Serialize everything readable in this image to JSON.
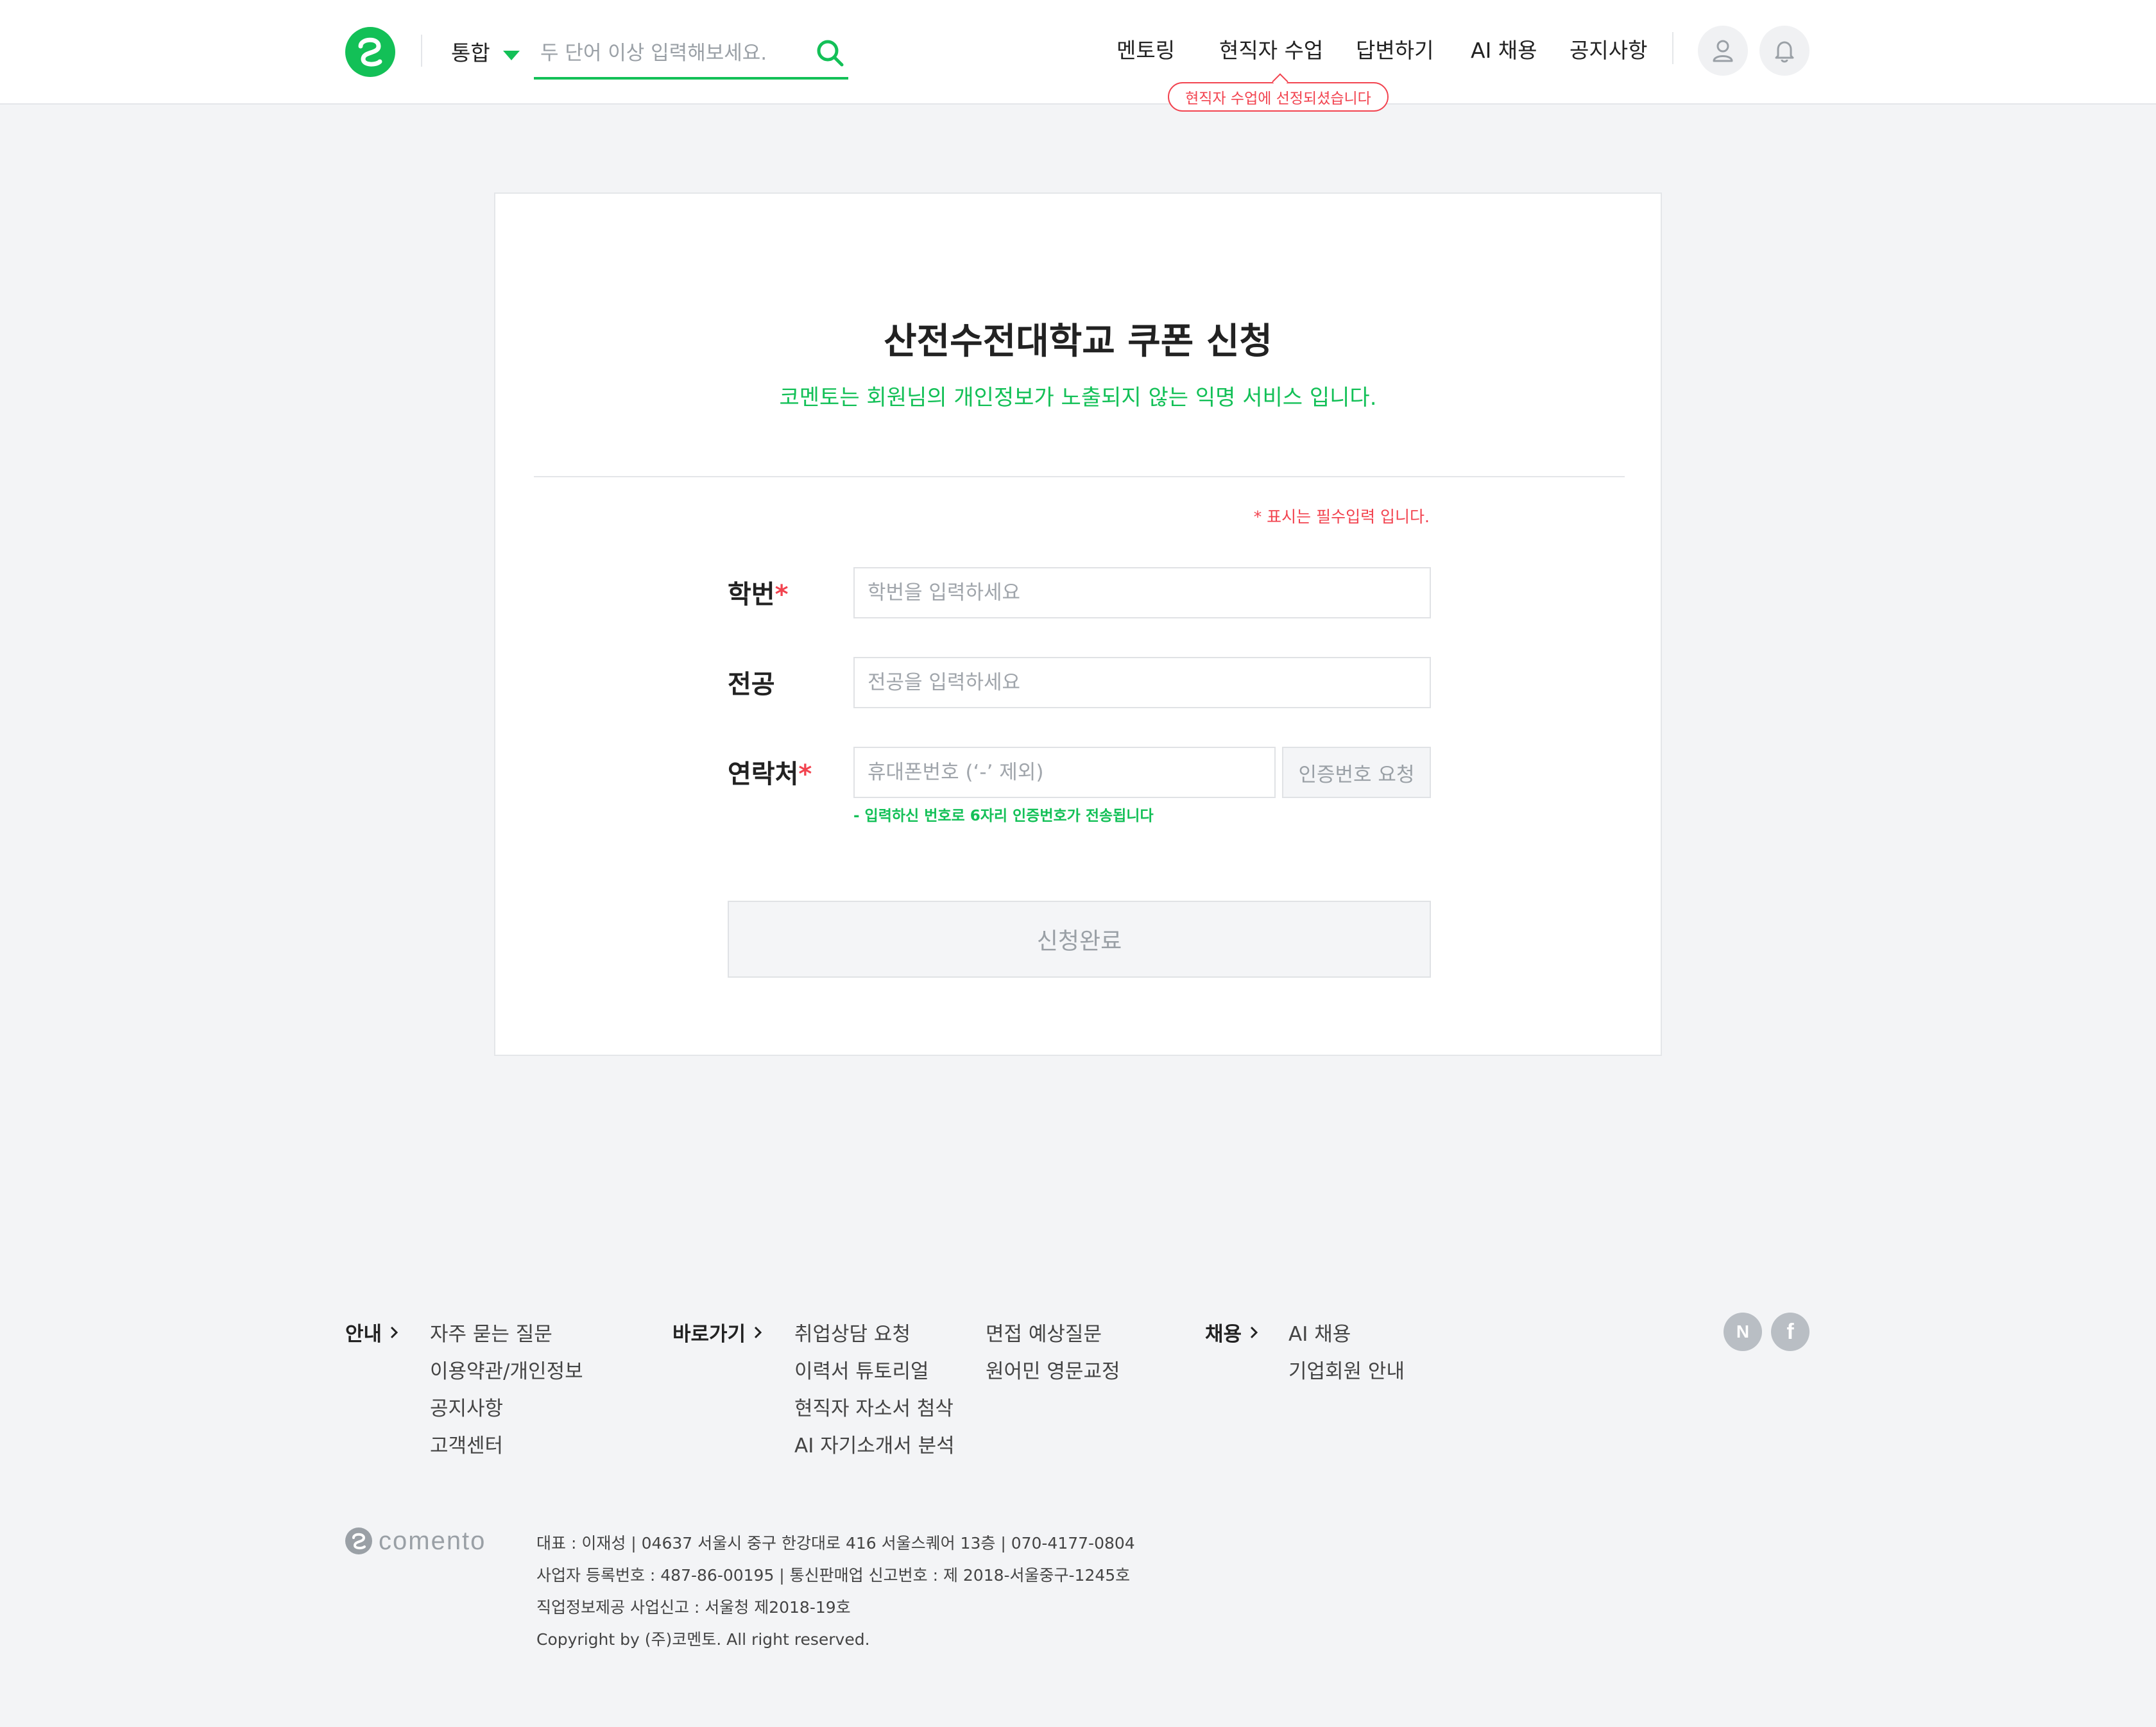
{
  "header": {
    "scope_label": "통합",
    "search_placeholder": "두 단어 이상 입력해보세요.",
    "nav": [
      "멘토링",
      "현직자 수업",
      "답변하기",
      "AI 채용",
      "공지사항"
    ],
    "tooltip": "현직자 수업에 선정되셨습니다"
  },
  "form": {
    "title": "산전수전대학교 쿠폰 신청",
    "subtitle": "코멘토는 회원님의 개인정보가 노출되지 않는 익명 서비스 입니다.",
    "required_note": "* 표시는 필수입력 입니다.",
    "student_id": {
      "label": "학번",
      "star": "*",
      "placeholder": "학번을 입력하세요"
    },
    "major": {
      "label": "전공",
      "placeholder": "전공을 입력하세요"
    },
    "phone": {
      "label": "연락처",
      "star": "*",
      "placeholder": "휴대폰번호 (‘-’ 제외)",
      "verify_label": "인증번호 요청",
      "helper": "- 입력하신 번호로 6자리 인증번호가 전송됩니다"
    },
    "submit_label": "신청완료"
  },
  "footer": {
    "guide": {
      "heading": "안내",
      "links": [
        "자주 묻는 질문",
        "이용약관/개인정보",
        "공지사항",
        "고객센터"
      ]
    },
    "shortcuts": {
      "heading": "바로가기",
      "col1": [
        "취업상담 요청",
        "이력서 튜토리얼",
        "현직자 자소서 첨삭",
        "AI 자기소개서 분석"
      ],
      "col2": [
        "면접 예상질문",
        "원어민 영문교정"
      ]
    },
    "hiring": {
      "heading": "채용",
      "links": [
        "AI 채용",
        "기업회원 안내"
      ]
    },
    "social": [
      "N",
      "f"
    ],
    "brand": "comento",
    "info": [
      "대표 : 이재성  |  04637 서울시 중구 한강대로 416 서울스퀘어 13층 | 070-4177-0804",
      "사업자 등록번호 : 487-86-00195  |  통신판매업 신고번호 : 제 2018-서울중구-1245호",
      "직업정보제공 사업신고 : 서울청 제2018-19호",
      "Copyright by (주)코멘토. All right reserved."
    ]
  },
  "colors": {
    "brand_green": "#13c057",
    "alert_red": "#f2434f",
    "background": "#f3f4f6"
  }
}
